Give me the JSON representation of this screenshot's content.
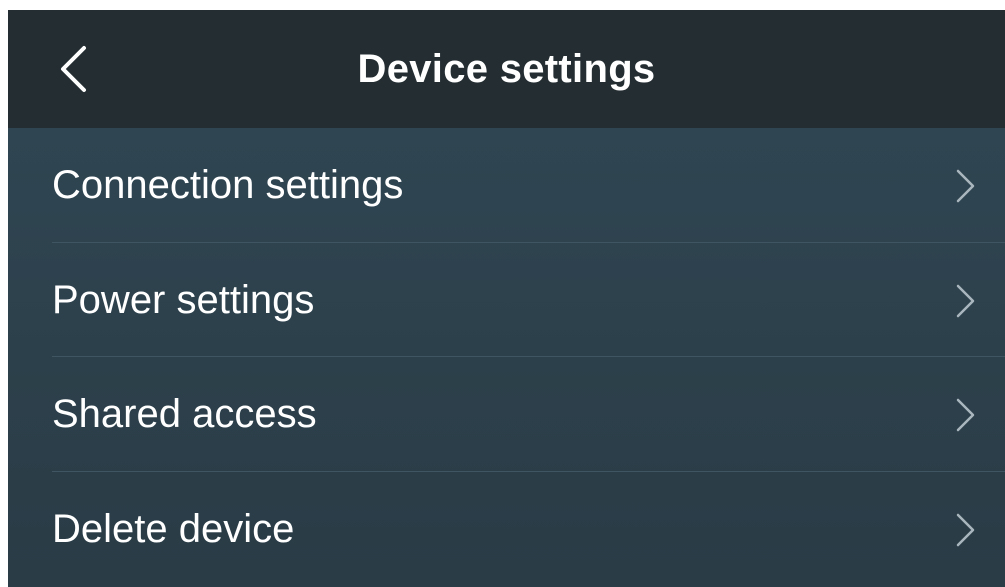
{
  "header": {
    "title": "Device settings",
    "back_icon": "chevron-left-icon",
    "background_color": "#232d32"
  },
  "list": {
    "background_color": "#2d424d",
    "items": [
      {
        "label": "Connection settings",
        "icon": "chevron-right-icon"
      },
      {
        "label": "Power settings",
        "icon": "chevron-right-icon"
      },
      {
        "label": "Shared access",
        "icon": "chevron-right-icon"
      },
      {
        "label": "Delete device",
        "icon": "chevron-right-icon"
      }
    ]
  },
  "colors": {
    "text": "#ffffff",
    "chevron": "#aab6bd",
    "divider": "#3f5662"
  }
}
